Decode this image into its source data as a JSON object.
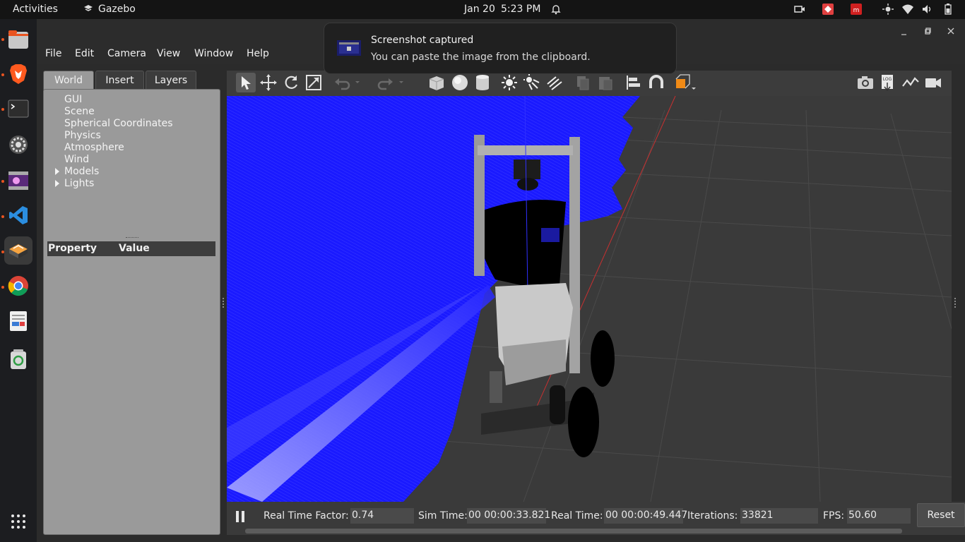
{
  "topbar": {
    "activities": "Activities",
    "app_name": "Gazebo",
    "date": "Jan 20",
    "time": "5:23 PM"
  },
  "dock": {
    "items": [
      "files-icon",
      "brave-icon",
      "terminal-icon",
      "settings-icon",
      "video-player-icon",
      "vscode-icon",
      "gazebo-icon",
      "chrome-icon",
      "text-editor-icon",
      "trash-icon",
      "app-grid-icon"
    ]
  },
  "menubar": {
    "items": [
      "File",
      "Edit",
      "Camera",
      "View",
      "Window",
      "Help"
    ]
  },
  "left_panel": {
    "tabs": [
      "World",
      "Insert",
      "Layers"
    ],
    "selected_tab": "World",
    "tree": [
      "GUI",
      "Scene",
      "Spherical Coordinates",
      "Physics",
      "Atmosphere",
      "Wind",
      "Models",
      "Lights"
    ],
    "expandable": [
      "Models",
      "Lights"
    ],
    "property_header": {
      "property": "Property",
      "value": "Value"
    }
  },
  "notification": {
    "title": "Screenshot captured",
    "body": "You can paste the image from the clipboard."
  },
  "status": {
    "rtf_label": "Real Time Factor:",
    "rtf_value": "0.74",
    "sim_time_label": "Sim Time:",
    "sim_time_value": "00 00:00:33.821",
    "real_time_label": "Real Time:",
    "real_time_value": "00 00:00:49.447",
    "iterations_label": "Iterations:",
    "iterations_value": "33821",
    "fps_label": "FPS:",
    "fps_value": "50.60",
    "reset_label": "Reset"
  },
  "colors": {
    "accent": "#e95420",
    "laser": "#1a1aff",
    "panel": "#9a9a9a"
  }
}
